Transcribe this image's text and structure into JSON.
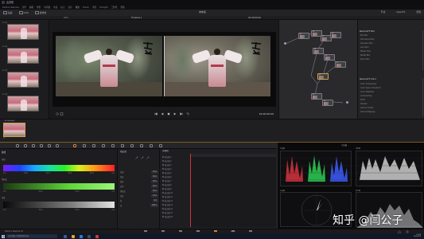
{
  "window": {
    "title": "达芬奇"
  },
  "menu": [
    "DaVinci Resolve",
    "文件",
    "编辑",
    "修剪",
    "时间线",
    "片段",
    "标记",
    "显示",
    "播放",
    "Fusion",
    "调色",
    "Fairlight",
    "工作区",
    "帮助"
  ],
  "toolbar": {
    "gallery": "画廊",
    "luts": "LUTs",
    "media_pool": "媒体池",
    "project_title": "未命名",
    "right_items": [
      "节点",
      "OpenFX",
      "剪辑"
    ]
  },
  "viewer": {
    "zoom": "32%",
    "clip_name": "Timeline 1",
    "source_tc": "01:00:00:00",
    "playhead_tc": "01:00:00:00"
  },
  "clip_strip": {
    "clip_tc": "01:00:00:00",
    "clip_label": "01"
  },
  "thumbnails": [
    {
      "num": "1.1.1"
    },
    {
      "num": "1.1.2"
    },
    {
      "num": "1.1.3"
    },
    {
      "num": "1.1.4"
    }
  ],
  "nodes": [
    {
      "label": "01"
    },
    {
      "label": "02"
    },
    {
      "label": "03"
    },
    {
      "label": "04"
    },
    {
      "label": "05"
    },
    {
      "label": "06"
    },
    {
      "label": "07"
    },
    {
      "label": "08"
    },
    {
      "label": "09"
    },
    {
      "label": "10"
    }
  ],
  "library": {
    "section_1": "ResolveFX Blur",
    "items_1": [
      "Box Blur",
      "Directional Blur",
      "Gaussian Blur",
      "Lens Blur",
      "Mosaic Blur",
      "Radial Blur",
      "Zoom Blur"
    ],
    "section_2": "ResolveFX Color",
    "items_2": [
      "Color Compressor",
      "Color Space Transform",
      "Color Stabilizer",
      "Contrast Pop",
      "DCTL",
      "Dehaze",
      "Gamut Limiter",
      "Gamut Mapping"
    ]
  },
  "primaries": {
    "title": "曲线",
    "hue_label": "色相",
    "hue_values": [
      "0.0",
      "50.0",
      "50.0",
      "50.0",
      "50.0",
      "0.0"
    ],
    "sat_label": "饱和度",
    "sat_values": [
      "0.0",
      "50.0",
      "50.0",
      "0.0"
    ],
    "lum_label": "亮度",
    "lum_values": [
      "0.0",
      "50.0",
      "50.0",
      "0.0"
    ]
  },
  "mid_panel": {
    "title": "限定器",
    "rows": [
      {
        "k": "色相",
        "v": "50.0"
      },
      {
        "k": "宽度",
        "v": "50.0"
      },
      {
        "k": "柔化",
        "v": "50.0"
      },
      {
        "k": "对称",
        "v": "50.0"
      },
      {
        "k": "饱和度",
        "v": "50.0"
      },
      {
        "k": "亮度",
        "v": "50.0"
      },
      {
        "k": "低",
        "v": "0.0"
      },
      {
        "k": "高",
        "v": "100.0"
      }
    ]
  },
  "keyframes": {
    "title": "关键帧",
    "rows": [
      "校正器 1",
      "校正器 2",
      "校正器 3",
      "校正器 4",
      "校正器 5",
      "校正器 6",
      "校正器 7",
      "校正器 8",
      "校正器 9",
      "校正器 10",
      "校正器 11",
      "校正器 12",
      "校正器 13",
      "校正器 14",
      "校正器 15",
      "校正器 16"
    ]
  },
  "scopes": {
    "title": "示波器",
    "labels": [
      "分量图",
      "波形图",
      "矢量图",
      "直方图"
    ]
  },
  "page_nav": {
    "brand": "DaVinci Resolve 16",
    "pages": [
      "媒体",
      "快编",
      "剪辑",
      "Fusion",
      "调色",
      "Fairlight",
      "交付"
    ],
    "active_index": 4
  },
  "taskbar": {
    "search_placeholder": "在这里输入你要搜索的内容",
    "time": "21:04",
    "date": "2020/1/5"
  },
  "watermark": "知乎 @闫公子",
  "colors": {
    "accent_orange": "#d2843a",
    "playhead_red": "#c63a3a",
    "panel_bg": "#1d1d20"
  }
}
